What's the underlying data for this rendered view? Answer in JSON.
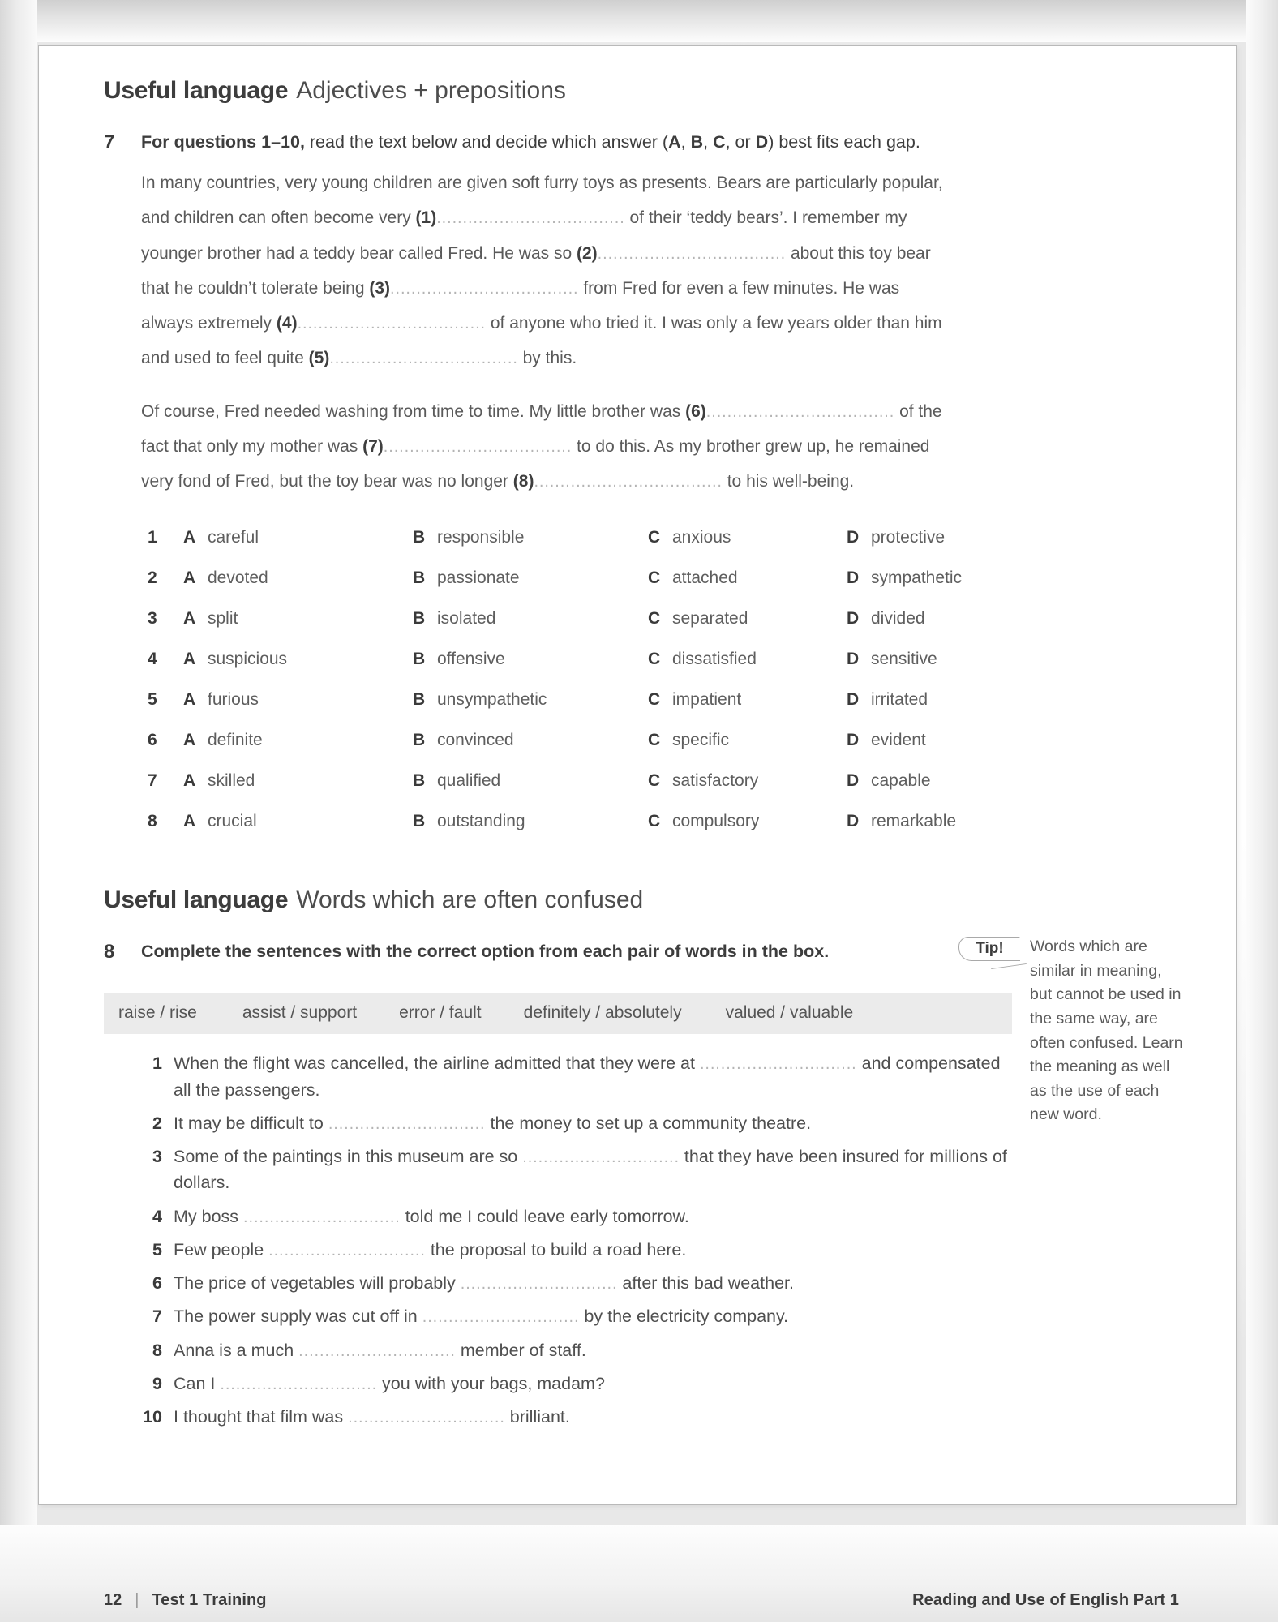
{
  "section1": {
    "heading_strong": "Useful language",
    "heading_light": "Adjectives + prepositions",
    "exercise_number": "7",
    "rubric_bold_1": "For questions 1–10,",
    "rubric_rest": " read the text below and decide which answer (",
    "rubric_a": "A",
    "rubric_comma1": ", ",
    "rubric_b": "B",
    "rubric_comma2": ", ",
    "rubric_c": "C",
    "rubric_or": ", or ",
    "rubric_d": "D",
    "rubric_tail": ") best fits each gap.",
    "para1_part1": "In many countries, very young children are given soft furry toys as presents. Bears are particularly popular, and children can often become very ",
    "para1_gap1": "(1)",
    "para1_part2": " of their ‘teddy bears’. I remember my younger brother had a teddy bear called Fred. He was so ",
    "para1_gap2": "(2)",
    "para1_part3": " about this toy bear that he couldn’t tolerate being ",
    "para1_gap3": "(3)",
    "para1_part4": " from Fred for even a few minutes. He was always extremely ",
    "para1_gap4": "(4)",
    "para1_part5": " of anyone who tried it. I was only a few years older than him and used to feel quite ",
    "para1_gap5": "(5)",
    "para1_part6": " by this.",
    "para2_part1": "Of course, Fred needed washing from time to time. My little brother was ",
    "para2_gap6": "(6)",
    "para2_part2": " of the fact that only my mother was ",
    "para2_gap7": "(7)",
    "para2_part3": " to do this. As my brother grew up, he remained very fond of Fred, but the toy bear was no longer ",
    "para2_gap8": "(8)",
    "para2_part4": " to his well-being.",
    "dots": "....................................",
    "options": [
      {
        "num": "1",
        "A": "careful",
        "B": "responsible",
        "C": "anxious",
        "D": "protective"
      },
      {
        "num": "2",
        "A": "devoted",
        "B": "passionate",
        "C": "attached",
        "D": "sympathetic"
      },
      {
        "num": "3",
        "A": "split",
        "B": "isolated",
        "C": "separated",
        "D": "divided"
      },
      {
        "num": "4",
        "A": "suspicious",
        "B": "offensive",
        "C": "dissatisfied",
        "D": "sensitive"
      },
      {
        "num": "5",
        "A": "furious",
        "B": "unsympathetic",
        "C": "impatient",
        "D": "irritated"
      },
      {
        "num": "6",
        "A": "definite",
        "B": "convinced",
        "C": "specific",
        "D": "evident"
      },
      {
        "num": "7",
        "A": "skilled",
        "B": "qualified",
        "C": "satisfactory",
        "D": "capable"
      },
      {
        "num": "8",
        "A": "crucial",
        "B": "outstanding",
        "C": "compulsory",
        "D": "remarkable"
      }
    ],
    "option_letters": {
      "a": "A",
      "b": "B",
      "c": "C",
      "d": "D"
    }
  },
  "section2": {
    "heading_strong": "Useful language",
    "heading_light": "Words which are often confused",
    "exercise_number": "8",
    "rubric": "Complete the sentences with the correct option from each pair of words in the box.",
    "word_bank": [
      "raise / rise",
      "assist / support",
      "error / fault",
      "definitely / absolutely",
      "valued / valuable"
    ],
    "dots": "..............................",
    "sentences": [
      {
        "num": "1",
        "before": "When the flight was cancelled, the airline admitted that they were at ",
        "after": " and compensated all the passengers."
      },
      {
        "num": "2",
        "before": "It may be difficult to ",
        "after": " the money to set up a community theatre."
      },
      {
        "num": "3",
        "before": "Some of the paintings in this museum are so ",
        "after": " that they have been insured for millions of dollars."
      },
      {
        "num": "4",
        "before": "My boss ",
        "after": " told me I could leave early tomorrow."
      },
      {
        "num": "5",
        "before": "Few people ",
        "after": " the proposal to build a road here."
      },
      {
        "num": "6",
        "before": "The price of vegetables will probably ",
        "after": " after this bad weather."
      },
      {
        "num": "7",
        "before": "The power supply was cut off in ",
        "after": " by the electricity company."
      },
      {
        "num": "8",
        "before": "Anna is a much ",
        "after": " member of staff."
      },
      {
        "num": "9",
        "before": "Can I ",
        "after": " you with your bags, madam?"
      },
      {
        "num": "10",
        "before": "I thought that film was ",
        "after": " brilliant."
      }
    ]
  },
  "tip": {
    "label": "Tip!",
    "text": "Words which are similar in meaning, but cannot be used in the same way, are often confused. Learn the meaning as well as the use of each new word."
  },
  "footer": {
    "page_number": "12",
    "divider": "|",
    "left_label": "Test 1 Training",
    "right_label": "Reading and Use of English Part 1"
  }
}
